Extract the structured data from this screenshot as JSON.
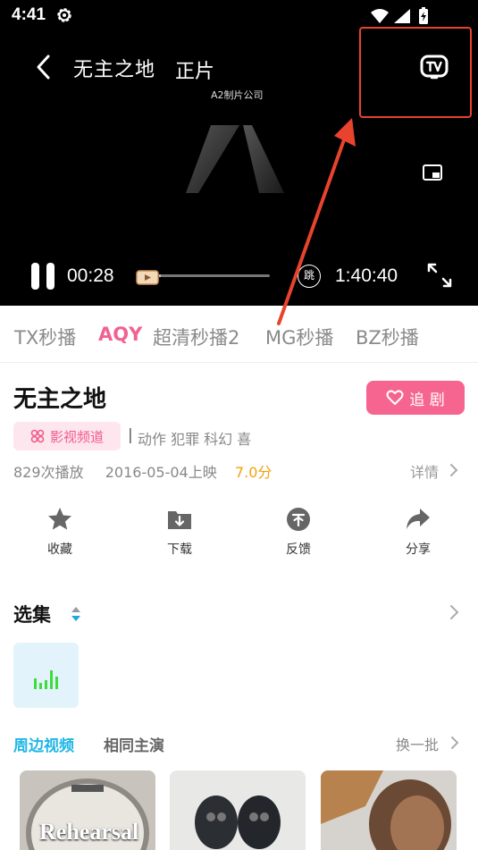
{
  "status_bar": {
    "time": "4:41"
  },
  "player": {
    "title": "无主之地",
    "subtitle": "正片",
    "company": "A2制片公司",
    "current_time": "00:28",
    "total_time": "1:40:40",
    "progress": 0.005,
    "skip_label": "跳"
  },
  "sources": [
    {
      "label": "TX秒播",
      "active": false
    },
    {
      "label": "AQY",
      "active": true
    },
    {
      "label": "超清秒播2",
      "active": false
    },
    {
      "label": "MG秒播",
      "active": false
    },
    {
      "label": "BZ秒播",
      "active": false
    }
  ],
  "info": {
    "title": "无主之地",
    "follow_label": "追 剧",
    "channel_label": "影视频道",
    "separator": "|",
    "genres": "动作 犯罪 科幻 喜",
    "plays": "829次播放",
    "release": "2016-05-04上映",
    "score": "7.0分",
    "details_label": "详情"
  },
  "actions": [
    {
      "label": "收藏",
      "icon": "star-icon"
    },
    {
      "label": "下载",
      "icon": "download-folder-icon"
    },
    {
      "label": "反馈",
      "icon": "feedback-icon"
    },
    {
      "label": "分享",
      "icon": "share-icon"
    }
  ],
  "episodes": {
    "title": "选集"
  },
  "related": {
    "tabs": [
      {
        "label": "周边视频",
        "active": true
      },
      {
        "label": "相同主演",
        "active": false
      }
    ],
    "refresh_label": "换一批",
    "thumb_caption": "Rehearsal"
  },
  "colors": {
    "accent_pink": "#f6658f",
    "accent_blue": "#1fb6e6",
    "score_orange": "#f2a10e",
    "annotation_red": "#e8432d"
  }
}
